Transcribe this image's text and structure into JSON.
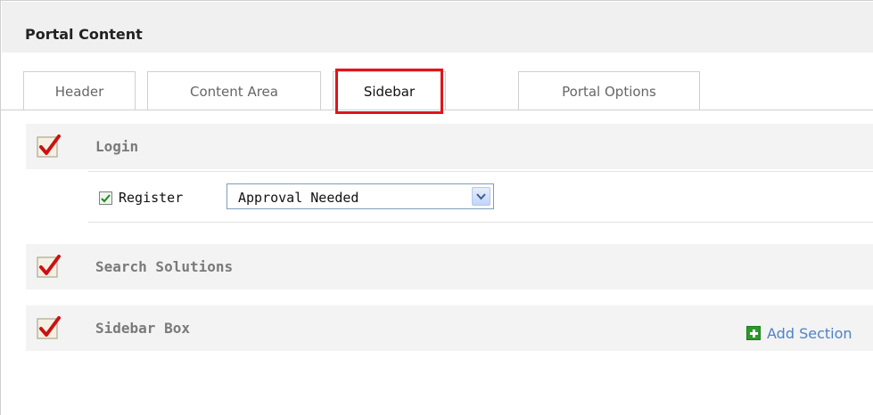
{
  "panel": {
    "title": "Portal Content"
  },
  "tabs": [
    {
      "label": "Header"
    },
    {
      "label": "Content Area"
    },
    {
      "label": "Sidebar",
      "active": true
    },
    {
      "label": "Portal Options"
    }
  ],
  "sections": {
    "login": {
      "label": "Login",
      "checked": true
    },
    "register": {
      "label": "Register",
      "checked": true,
      "select_value": "Approval Needed"
    },
    "search": {
      "label": "Search Solutions",
      "checked": true
    },
    "sidebar_box": {
      "label": "Sidebar Box",
      "checked": true,
      "add_label": "Add Section"
    }
  },
  "colors": {
    "check_red": "#cc1111",
    "highlight": "#e0141a",
    "link_blue": "#4f81c7",
    "plus_green": "#2a9a2a"
  }
}
